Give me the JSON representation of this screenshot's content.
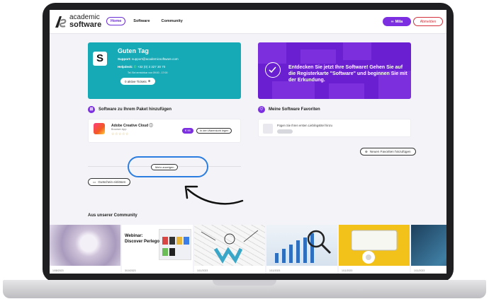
{
  "logo": {
    "line1": "academic",
    "line2": "software"
  },
  "nav": [
    {
      "label": "Home"
    },
    {
      "label": "Software"
    },
    {
      "label": "Community"
    }
  ],
  "user": {
    "name": "Mila",
    "logout": "Abmelden"
  },
  "greeting": {
    "title": "Guten Tag",
    "support_label": "Support:",
    "support_email": "support@academicsoftware.com",
    "helpdesk_label": "Helpdesk:",
    "helpdesk_phone": "+32 (0) 3 327 30 70",
    "hours": "Tel. Bei erreichbar von 09:00 - 17:00",
    "tickets_btn": "0 aktive Tickets"
  },
  "promo": {
    "text": "Entdecken Sie jetzt Ihre Software! Gehen Sie auf die Registerkarte \"Software\" und beginnen Sie mit der Erkundung."
  },
  "sections": {
    "add_software": "Software zu Ihrem Paket hinzufügen",
    "favorites": "Meine Software Favoriten"
  },
  "software_item": {
    "name": "Adobe Creative Cloud",
    "subtitle": "Browser App",
    "stars": "☆☆☆☆☆",
    "price": "€ 99",
    "cart_btn": "In den Warenkorb legen"
  },
  "favorites": {
    "empty_text": "Fügen Sie Ihren ersten Lieblingstitel hinzu",
    "add_btn": "Neuen Favoriten hinzufügen"
  },
  "more_btn": "Mehr anzeigen",
  "voucher_btn": "Gutschein einlösen",
  "community": {
    "title": "Aus unserer Community",
    "tiles": [
      {
        "date": "1/08/2023",
        "webinar": ""
      },
      {
        "date": "3/10/2023",
        "webinar": "Webinar: Discover Perlego"
      },
      {
        "date": "1/11/2023",
        "webinar": ""
      },
      {
        "date": "1/11/2023",
        "webinar": ""
      },
      {
        "date": "1/11/2023",
        "webinar": ""
      },
      {
        "date": "1/11/2023",
        "webinar": ""
      }
    ]
  },
  "colors": {
    "brand_purple": "#7b2fe0",
    "teal": "#16a9b6",
    "logout_red": "#d2303a",
    "highlight_blue": "#2b7de0"
  }
}
